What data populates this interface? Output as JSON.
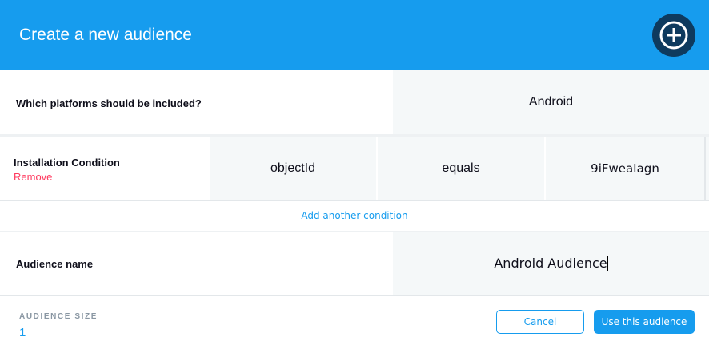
{
  "header": {
    "title": "Create a new audience",
    "add_icon": "plus-circle-icon"
  },
  "platforms": {
    "label": "Which platforms should be included?",
    "value": "Android"
  },
  "condition": {
    "title": "Installation Condition",
    "remove_label": "Remove",
    "field": "objectId",
    "operator": "equals",
    "value": "9iFweaIagn"
  },
  "add_condition_label": "Add another condition",
  "audience_name": {
    "label": "Audience name",
    "value": "Android Audience"
  },
  "footer": {
    "size_label": "AUDIENCE SIZE",
    "size_value": "1",
    "cancel_label": "Cancel",
    "use_label": "Use this audience"
  },
  "colors": {
    "accent": "#169cee",
    "danger": "#ff395e",
    "cell_bg": "#f5f8f9"
  }
}
